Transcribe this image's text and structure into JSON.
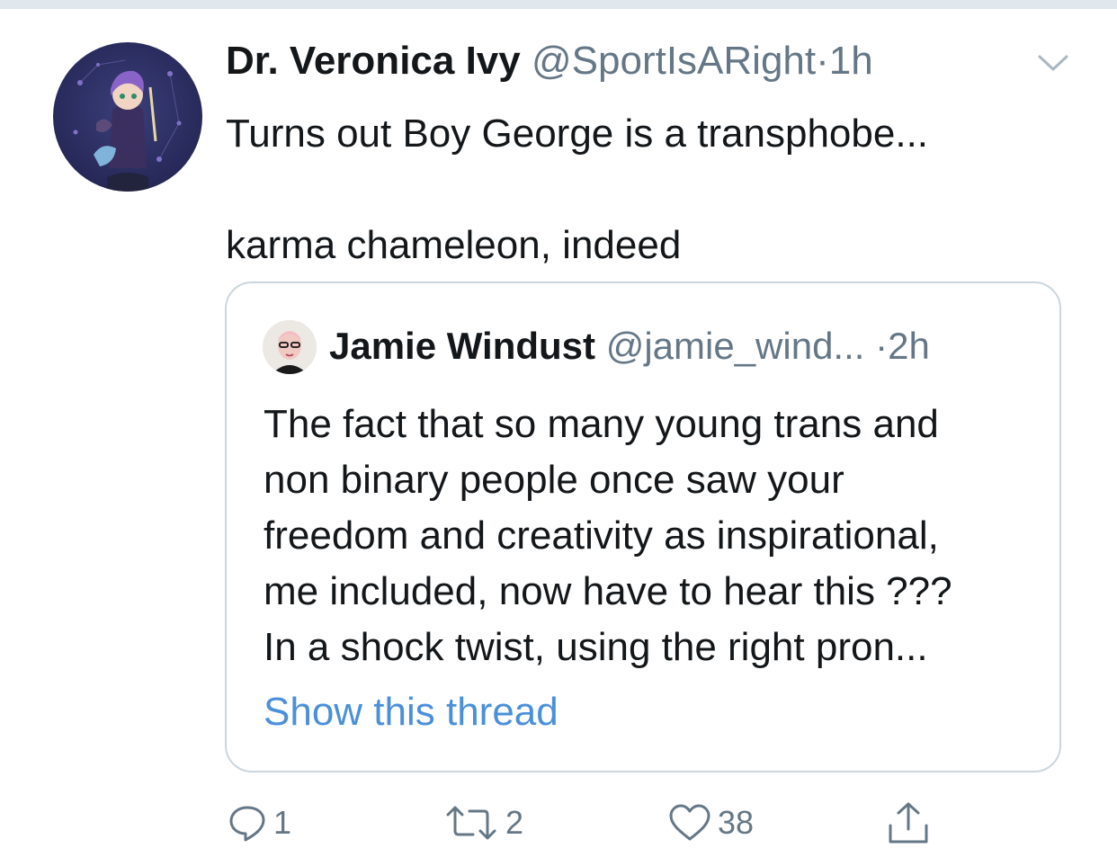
{
  "tweet": {
    "display_name": "Dr. Veronica Ivy",
    "handle": "@SportIsARight",
    "separator": "·",
    "time": "1h",
    "text_lines": [
      "Turns out Boy George is a transphobe...",
      "karma chameleon, indeed"
    ],
    "avatar_icon": "illustrated-avatar-icon",
    "caret_icon": "chevron-down-icon"
  },
  "quote": {
    "display_name": "Jamie Windust",
    "handle": "@jamie_wind...",
    "separator": "·",
    "time": "2h",
    "text_lines": [
      "The fact that so many young trans and",
      "non binary people once saw your",
      "freedom and creativity as inspirational,",
      "me included, now have to hear this ???",
      "In a shock twist, using the right pron..."
    ],
    "show_thread": "Show this thread",
    "link_color": "#4a90d9"
  },
  "actions": {
    "reply": {
      "icon": "reply-icon",
      "count": "1"
    },
    "retweet": {
      "icon": "retweet-icon",
      "count": "2"
    },
    "like": {
      "icon": "heart-icon",
      "count": "38"
    },
    "share": {
      "icon": "share-icon"
    }
  },
  "colors": {
    "text": "#14171a",
    "muted": "#657786",
    "border": "#ccd6dd",
    "link": "#4a90d9"
  }
}
